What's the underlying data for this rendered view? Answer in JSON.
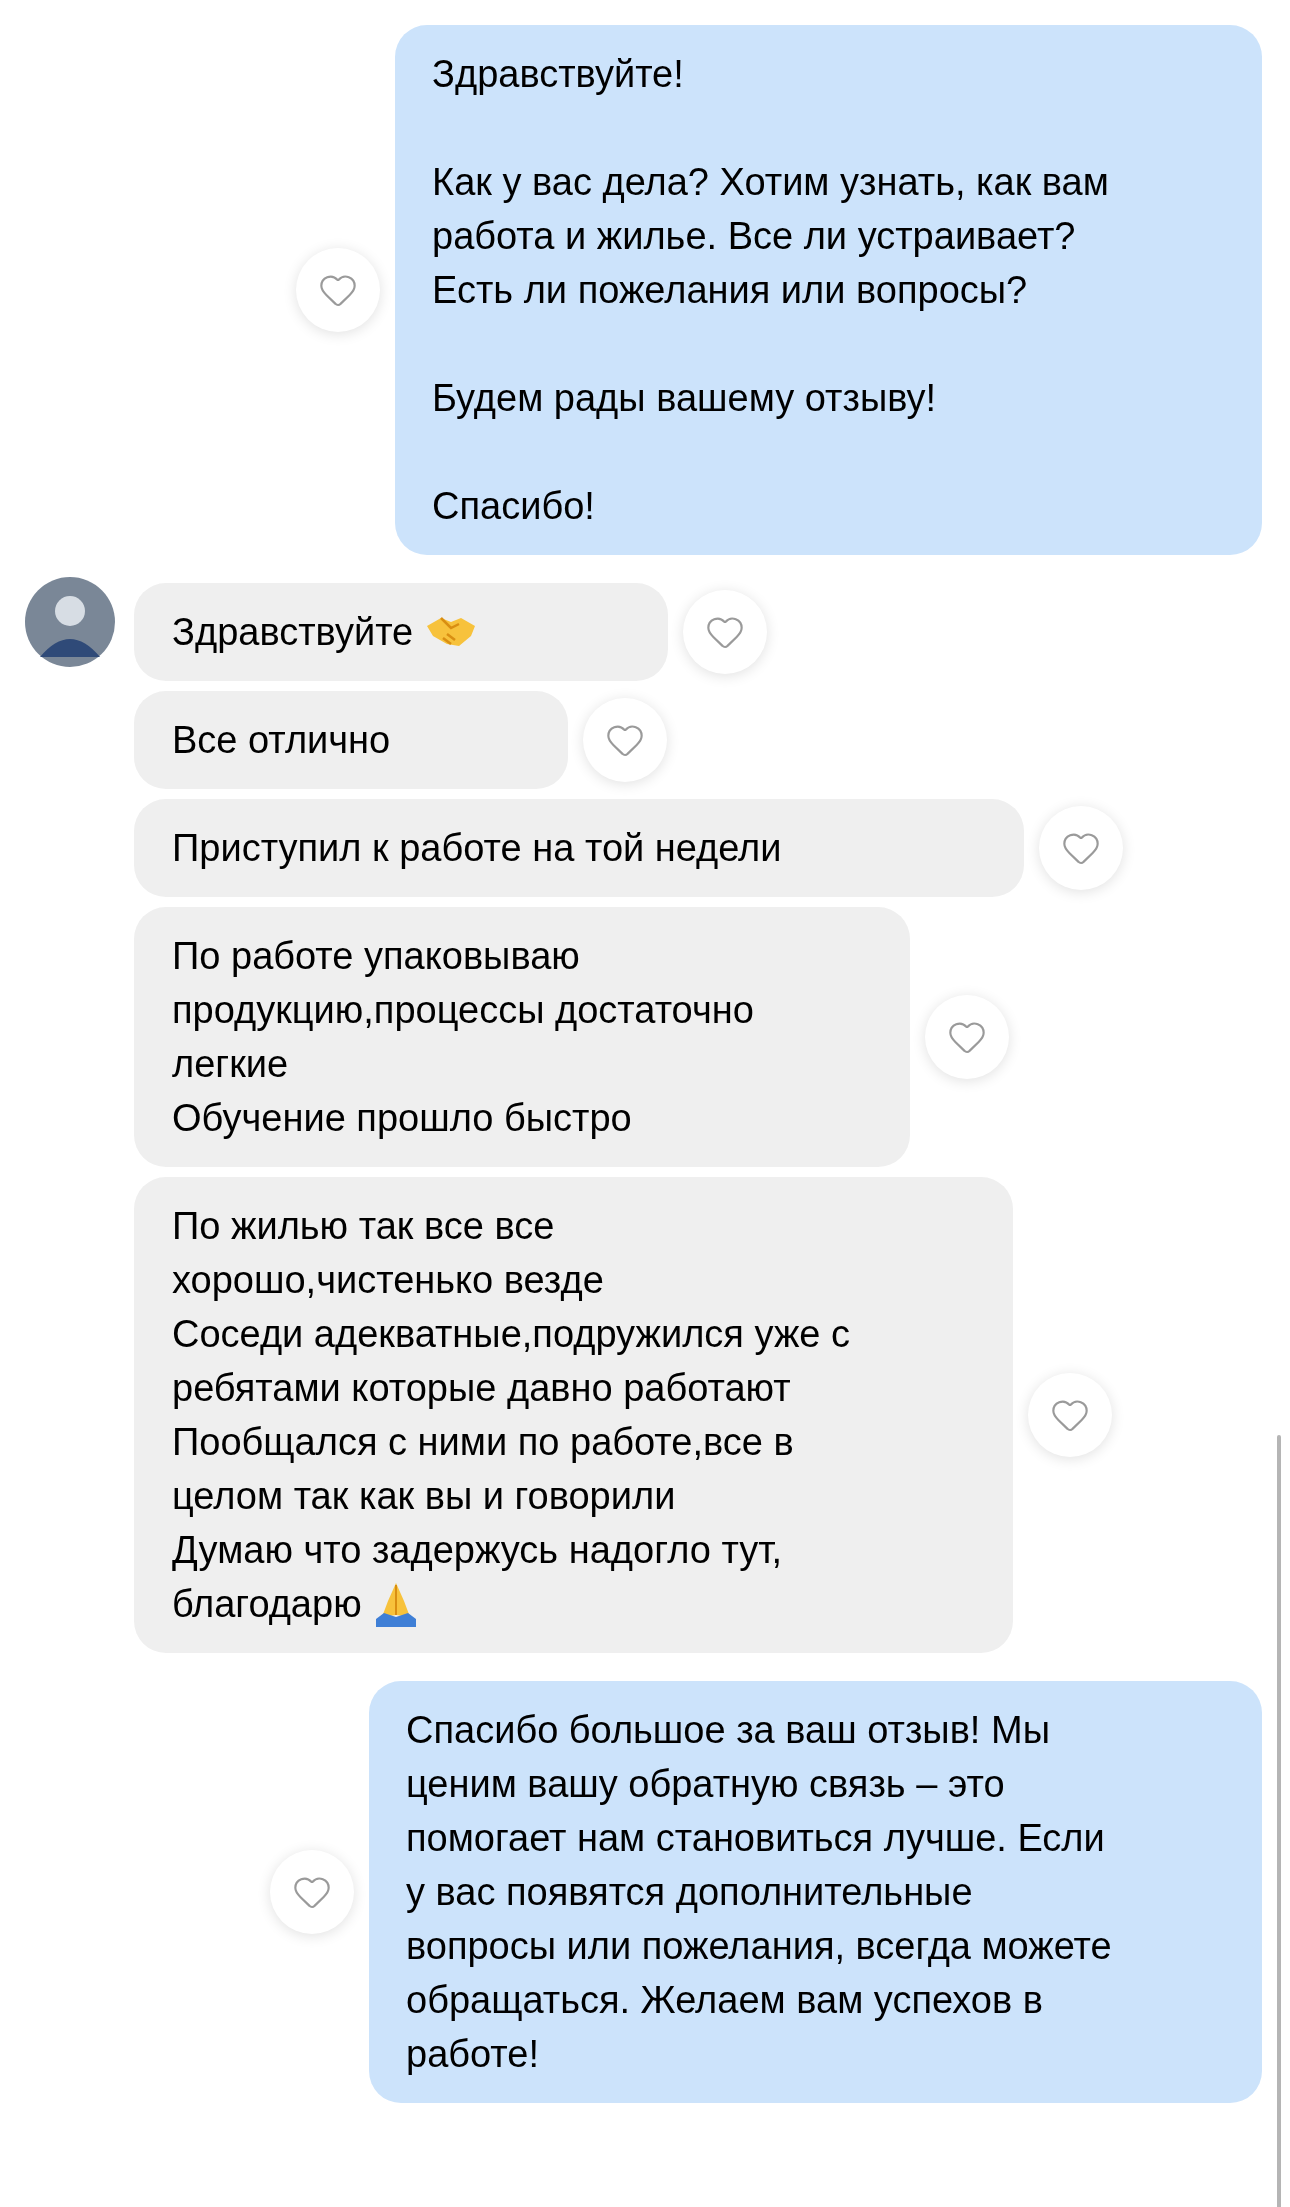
{
  "thread": [
    {
      "kind": "outgoing",
      "liked": false,
      "paragraphs": [
        [
          "Здравствуйте!"
        ],
        [
          "Как у вас дела? Хотим узнать, как вам",
          "работа и жилье. Все ли устраивает?",
          "Есть ли пожелания или вопросы?"
        ],
        [
          "Будем рады вашему отзыву!"
        ],
        [
          "Спасибо!"
        ]
      ]
    },
    {
      "kind": "incoming_group",
      "messages": [
        {
          "kind": "handshake",
          "liked": false,
          "lines": [
            "Здравствуйте"
          ]
        },
        {
          "kind": "text",
          "liked": false,
          "lines": [
            "Все отлично"
          ]
        },
        {
          "kind": "text",
          "liked": false,
          "lines": [
            "Приступил к работе на той недели"
          ]
        },
        {
          "kind": "text",
          "liked": false,
          "lines": [
            "По работе упаковываю",
            "продукцию,процессы достаточно",
            "легкие",
            "Обучение прошло быстро"
          ]
        },
        {
          "kind": "praying_hands",
          "liked": false,
          "lines": [
            "По жилью так все все",
            "хорошо,чистенько везде",
            "Соседи адекватные,подружился уже с",
            "ребятами которые давно работают",
            "Пообщался с ними по работе,все в",
            "целом так как вы и говорили",
            "Думаю что задержусь надогло тут,",
            "благодарю"
          ]
        }
      ]
    },
    {
      "kind": "outgoing",
      "liked": false,
      "paragraphs": [
        [
          "Спасибо большое за ваш отзыв! Мы",
          "ценим вашу обратную связь – это",
          "помогает нам становиться лучше. Если",
          "у вас появятся дополнительные",
          "вопросы или пожелания, всегда можете",
          "обращаться. Желаем вам успехов в",
          "работе!"
        ]
      ]
    }
  ]
}
